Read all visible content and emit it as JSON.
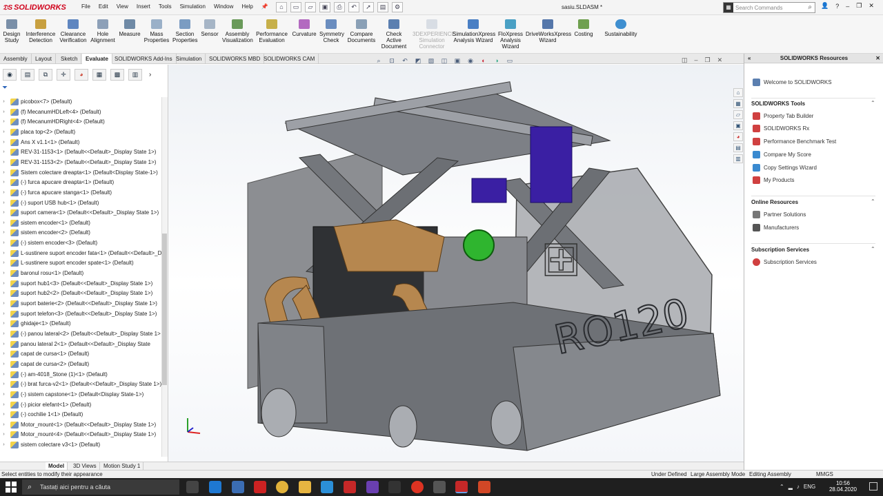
{
  "app": {
    "brand": "SOLIDWORKS",
    "document_title": "sasiu.SLDASM *",
    "menus": [
      "File",
      "Edit",
      "View",
      "Insert",
      "Tools",
      "Simulation",
      "Window",
      "Help"
    ],
    "search_placeholder": "Search Commands",
    "accent": "#d0021b"
  },
  "commands": [
    {
      "label": "Design Study",
      "icon": "design-study-icon"
    },
    {
      "label": "Interference Detection",
      "icon": "interference-icon"
    },
    {
      "label": "Clearance Verification",
      "icon": "clearance-icon"
    },
    {
      "label": "Hole Alignment",
      "icon": "hole-icon"
    },
    {
      "label": "Measure",
      "icon": "measure-icon"
    },
    {
      "label": "Mass Properties",
      "icon": "mass-icon"
    },
    {
      "label": "Section Properties",
      "icon": "section-icon"
    },
    {
      "label": "Sensor",
      "icon": "sensor-icon"
    },
    {
      "label": "Assembly Visualization",
      "icon": "assembly-viz-icon"
    },
    {
      "label": "Performance Evaluation",
      "icon": "performance-icon"
    },
    {
      "label": "Curvature",
      "icon": "curvature-icon"
    },
    {
      "label": "Symmetry Check",
      "icon": "symmetry-icon"
    },
    {
      "label": "Compare Documents",
      "icon": "compare-icon"
    },
    {
      "label": "Check Active Document",
      "icon": "check-icon"
    },
    {
      "label": "3DEXPERIENCE Simulation Connector",
      "icon": "3dx-icon",
      "disabled": true
    },
    {
      "label": "SimulationXpress Analysis Wizard",
      "icon": "simxpress-icon"
    },
    {
      "label": "FloXpress Analysis Wizard",
      "icon": "floxpress-icon"
    },
    {
      "label": "DriveWorksXpress Wizard",
      "icon": "driveworks-icon"
    },
    {
      "label": "Costing",
      "icon": "costing-icon"
    },
    {
      "label": "Sustainability",
      "icon": "sustainability-icon"
    }
  ],
  "tabs": [
    "Assembly",
    "Layout",
    "Sketch",
    "Evaluate",
    "SOLIDWORKS Add-Ins",
    "Simulation",
    "SOLIDWORKS MBD",
    "SOLIDWORKS CAM"
  ],
  "active_tab": "Evaluate",
  "tree": [
    "picobox<7> (Default)",
    "(f) MecanumHDLeft<4> (Default)",
    "(f) MecanumHDRight<4> (Default)",
    "placa top<2> (Default)",
    "Ans X v1.1<1> (Default)",
    "REV-31-1153<1> (Default<<Default>_Display State 1>)",
    "REV-31-1153<2> (Default<<Default>_Display State 1>)",
    "Sistem colectare dreapta<1> (Default<Display State-1>)",
    "(-) furca apucare dreapta<1> (Default)",
    "(-) furca apucare stanga<1> (Default)",
    "(-) suport USB hub<1> (Default)",
    "suport camera<1> (Default<<Default>_Display State 1>)",
    "sistem encoder<1> (Default)",
    "sistem encoder<2> (Default)",
    "(-) sistem encoder<3> (Default)",
    "L-sustinere suport encoder fata<1> (Default<<Default>_D",
    "L-sustinere suport encoder spate<1> (Default)",
    "baronul rosu<1> (Default)",
    "suport hub1<3> (Default<<Default>_Display State 1>)",
    "suport hub2<2> (Default<<Default>_Display State 1>)",
    "suport baterie<2> (Default<<Default>_Display State 1>)",
    "suport telefon<3> (Default<<Default>_Display State 1>)",
    "ghidaje<1> (Default)",
    "(-) panou lateral<2> (Default<<Default>_Display State 1>",
    "panou lateral 2<1> (Default<<Default>_Display State",
    "capat de cursa<1> (Default)",
    "capat de cursa<2> (Default)",
    "(-) am-4018_Stone (1)<1> (Default)",
    "(-) brat furca-v2<1> (Default<<Default>_Display State 1>)",
    "(-) sistem capstone<1> (Default<Display State-1>)",
    "(-) picior elefant<1> (Default)",
    "(-) cochilie 1<1> (Default)",
    "Motor_mount<1> (Default<<Default>_Display State 1>)",
    "Motor_mount<4> (Default<<Default>_Display State 1>)",
    "sistem colectare v3<1> (Default)"
  ],
  "bottom_tabs": [
    "Model",
    "3D Views",
    "Motion Study 1"
  ],
  "resources": {
    "title": "SOLIDWORKS Resources",
    "welcome": "Welcome to SOLIDWORKS",
    "tools_title": "SOLIDWORKS Tools",
    "tools": [
      "Property Tab Builder",
      "SOLIDWORKS Rx",
      "Performance Benchmark Test",
      "Compare My Score",
      "Copy Settings Wizard",
      "My Products"
    ],
    "online_title": "Online Resources",
    "online": [
      "Partner Solutions",
      "Manufacturers"
    ],
    "subscription_title": "Subscription Services",
    "subscription": [
      "Subscription Services"
    ]
  },
  "model": {
    "plate_text": "RO120"
  },
  "status": {
    "message": "Select entities to modify their appearance",
    "under_defined": "Under Defined",
    "large_assembly": "Large Assembly Mode",
    "editing": "Editing Assembly",
    "units": "MMGS"
  },
  "taskbar": {
    "search_placeholder": "Tastați aici pentru a căuta",
    "lang": "ENG",
    "time": "10:56",
    "date": "28.04.2020"
  }
}
